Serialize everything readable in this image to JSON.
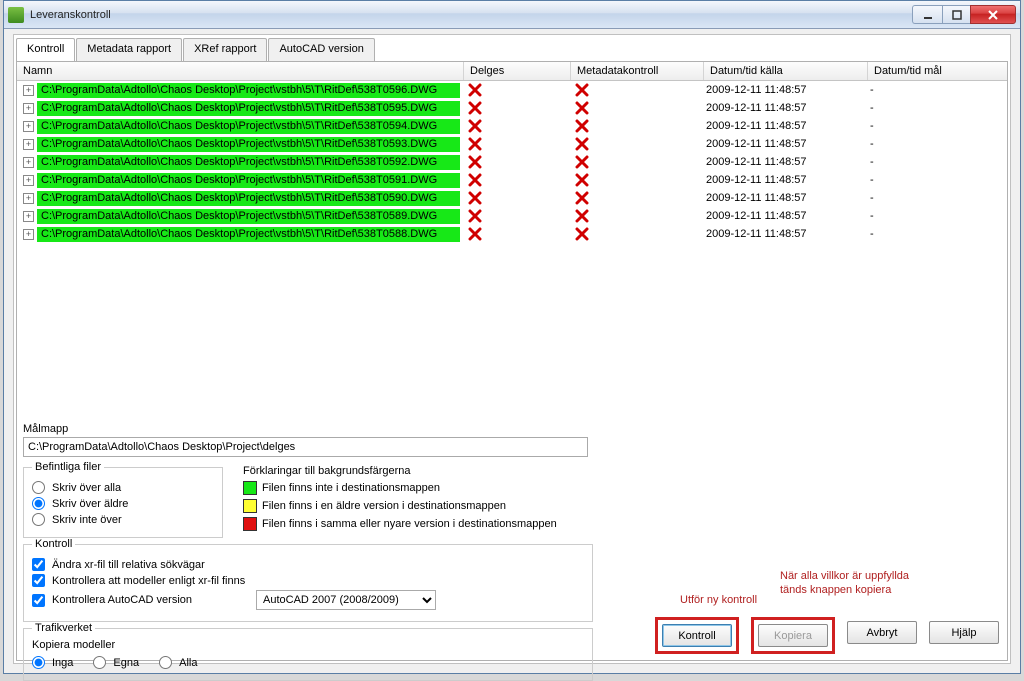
{
  "window": {
    "title": "Leveranskontroll"
  },
  "tabs": [
    {
      "label": "Kontroll",
      "active": true
    },
    {
      "label": "Metadata rapport"
    },
    {
      "label": "XRef rapport"
    },
    {
      "label": "AutoCAD version"
    }
  ],
  "columns": {
    "namn": "Namn",
    "delges": "Delges",
    "meta": "Metadatakontroll",
    "kalla": "Datum/tid källa",
    "mal": "Datum/tid mål"
  },
  "rows": [
    {
      "path": "C:\\ProgramData\\Adtollo\\Chaos Desktop\\Project\\vstbh\\5\\T\\RitDef\\538T0596.DWG",
      "kalla": "2009-12-11 11:48:57",
      "mal": "-"
    },
    {
      "path": "C:\\ProgramData\\Adtollo\\Chaos Desktop\\Project\\vstbh\\5\\T\\RitDef\\538T0595.DWG",
      "kalla": "2009-12-11 11:48:57",
      "mal": "-"
    },
    {
      "path": "C:\\ProgramData\\Adtollo\\Chaos Desktop\\Project\\vstbh\\5\\T\\RitDef\\538T0594.DWG",
      "kalla": "2009-12-11 11:48:57",
      "mal": "-"
    },
    {
      "path": "C:\\ProgramData\\Adtollo\\Chaos Desktop\\Project\\vstbh\\5\\T\\RitDef\\538T0593.DWG",
      "kalla": "2009-12-11 11:48:57",
      "mal": "-"
    },
    {
      "path": "C:\\ProgramData\\Adtollo\\Chaos Desktop\\Project\\vstbh\\5\\T\\RitDef\\538T0592.DWG",
      "kalla": "2009-12-11 11:48:57",
      "mal": "-"
    },
    {
      "path": "C:\\ProgramData\\Adtollo\\Chaos Desktop\\Project\\vstbh\\5\\T\\RitDef\\538T0591.DWG",
      "kalla": "2009-12-11 11:48:57",
      "mal": "-"
    },
    {
      "path": "C:\\ProgramData\\Adtollo\\Chaos Desktop\\Project\\vstbh\\5\\T\\RitDef\\538T0590.DWG",
      "kalla": "2009-12-11 11:48:57",
      "mal": "-"
    },
    {
      "path": "C:\\ProgramData\\Adtollo\\Chaos Desktop\\Project\\vstbh\\5\\T\\RitDef\\538T0589.DWG",
      "kalla": "2009-12-11 11:48:57",
      "mal": "-"
    },
    {
      "path": "C:\\ProgramData\\Adtollo\\Chaos Desktop\\Project\\vstbh\\5\\T\\RitDef\\538T0588.DWG",
      "kalla": "2009-12-11 11:48:57",
      "mal": "-"
    }
  ],
  "malmapp": {
    "label": "Målmapp",
    "value": "C:\\ProgramData\\Adtollo\\Chaos Desktop\\Project\\delges"
  },
  "befintliga": {
    "title": "Befintliga filer",
    "opt1": "Skriv över alla",
    "opt2": "Skriv över äldre",
    "opt3": "Skriv inte över"
  },
  "forklaringar": {
    "title": "Förklaringar till bakgrundsfärgerna",
    "green": "Filen finns inte i destinationsmappen",
    "yellow": "Filen finns i en äldre version i destinationsmappen",
    "red": "Filen finns i samma eller nyare version i destinationsmappen"
  },
  "kontroll": {
    "title": "Kontroll",
    "chk1": "Ändra xr-fil till relativa sökvägar",
    "chk2": "Kontrollera att modeller enligt xr-fil finns",
    "chk3": "Kontrollera AutoCAD version",
    "version": "AutoCAD 2007 (2008/2009)"
  },
  "trafikverket": {
    "title": "Trafikverket",
    "sub": "Kopiera modeller",
    "r1": "Inga",
    "r2": "Egna",
    "r3": "Alla"
  },
  "annots": {
    "a1": "Utför ny kontroll",
    "a2": "När alla villkor är uppfyllda tänds knappen kopiera"
  },
  "buttons": {
    "kontroll": "Kontroll",
    "kopiera": "Kopiera",
    "avbryt": "Avbryt",
    "hjalp": "Hjälp"
  }
}
